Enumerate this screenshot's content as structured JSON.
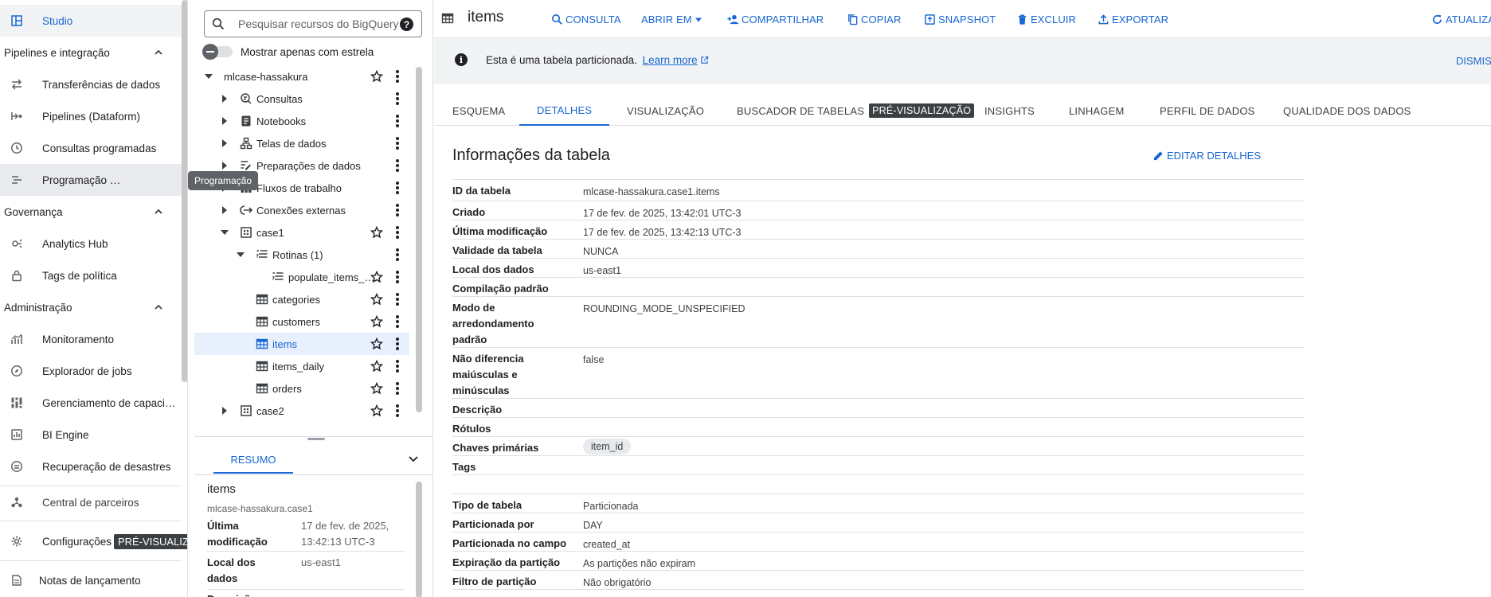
{
  "nav": {
    "studio": "Studio",
    "sections": {
      "pipelines": "Pipelines e integração",
      "governance": "Governança",
      "admin": "Administração"
    },
    "items": {
      "transfers": "Transferências de dados",
      "pipelines_dataform": "Pipelines (Dataform)",
      "scheduled_queries": "Consultas programadas",
      "scheduling": "Programação …",
      "analytics_hub": "Analytics Hub",
      "policy_tags": "Tags de política",
      "monitoring": "Monitoramento",
      "job_explorer": "Explorador de jobs",
      "capacity": "Gerenciamento de capaci…",
      "bi_engine": "BI Engine",
      "disaster_recovery": "Recuperação de desastres",
      "partner_center": "Central de parceiros",
      "settings": "Configurações",
      "settings_badge": "PRÉ-VISUALIZAÇÃO",
      "release_notes": "Notas de lançamento"
    },
    "tooltip": "Programação"
  },
  "explorer": {
    "search_placeholder": "Pesquisar recursos do BigQuery",
    "star_toggle_label": "Mostrar apenas com estrela",
    "tree": {
      "project": "mlcase-hassakura",
      "consultas": "Consultas",
      "notebooks": "Notebooks",
      "canvases": "Telas de dados",
      "data_preps": "Preparações de dados",
      "workflows": "Fluxos de trabalho",
      "connections": "Conexões externas",
      "case1": "case1",
      "routines": "Rotinas (1)",
      "routine_item": "populate_items_…",
      "categories": "categories",
      "customers": "customers",
      "items": "items",
      "items_daily": "items_daily",
      "orders": "orders",
      "case2": "case2"
    },
    "summary": {
      "tab": "RESUMO",
      "title": "items",
      "subtitle": "mlcase-hassakura.case1",
      "rows": [
        {
          "key": "Última modificação",
          "value": "17 de fev. de 2025, 13:42:13 UTC-3"
        },
        {
          "key": "Local dos dados",
          "value": "us-east1"
        },
        {
          "key": "Descrição",
          "value": ""
        }
      ]
    }
  },
  "toolbar": {
    "title": "items",
    "query": "CONSULTA",
    "open_in": "ABRIR EM",
    "share": "COMPARTILHAR",
    "copy": "COPIAR",
    "snapshot": "SNAPSHOT",
    "delete": "EXCLUIR",
    "export": "EXPORTAR",
    "refresh": "ATUALIZAR"
  },
  "banner": {
    "text": "Esta é uma tabela particionada.",
    "link": "Learn more",
    "dismiss": "DISMISS"
  },
  "tabs": {
    "schema": "ESQUEMA",
    "details": "DETALHES",
    "preview": "VISUALIZAÇÃO",
    "table_explorer": "BUSCADOR DE TABELAS",
    "table_explorer_badge": "PRÉ-VISUALIZAÇÃO",
    "insights": "INSIGHTS",
    "lineage": "LINHAGEM",
    "data_profile": "PERFIL DE DADOS",
    "data_quality": "QUALIDADE DOS DADOS"
  },
  "details": {
    "title": "Informações da tabela",
    "edit": "EDITAR DETALHES",
    "rows": [
      {
        "key": "ID da tabela",
        "value": "mlcase-hassakura.case1.items"
      },
      {
        "key": "Criado",
        "value": "17 de fev. de 2025, 13:42:01 UTC-3"
      },
      {
        "key": "Última modificação",
        "value": "17 de fev. de 2025, 13:42:13 UTC-3"
      },
      {
        "key": "Validade da tabela",
        "value": "NUNCA"
      },
      {
        "key": "Local dos dados",
        "value": "us-east1"
      },
      {
        "key": "Compilação padrão",
        "value": ""
      },
      {
        "key": "Modo de arredondamento padrão",
        "value": "ROUNDING_MODE_UNSPECIFIED"
      },
      {
        "key": "Não diferencia maiúsculas e minúsculas",
        "value": "false"
      },
      {
        "key": "Descrição",
        "value": ""
      },
      {
        "key": "Rótulos",
        "value": ""
      },
      {
        "key": "Chaves primárias",
        "value": "item_id"
      },
      {
        "key": "Tags",
        "value": ""
      },
      {
        "key": "Tipo de tabela",
        "value": "Particionada"
      },
      {
        "key": "Particionada por",
        "value": "DAY"
      },
      {
        "key": "Particionada no campo",
        "value": "created_at"
      },
      {
        "key": "Expiração da partição",
        "value": "As partições não expiram"
      },
      {
        "key": "Filtro de partição",
        "value": "Não obrigatório"
      }
    ]
  }
}
